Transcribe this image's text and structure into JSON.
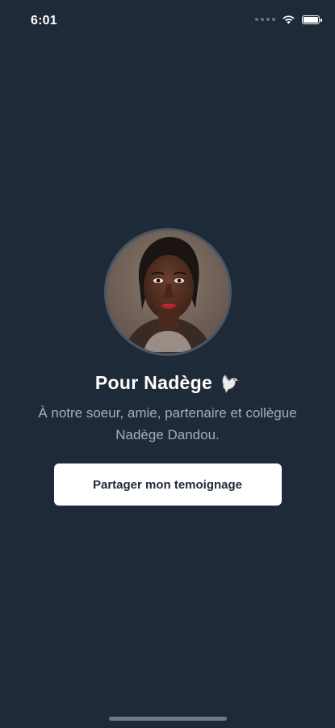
{
  "status_bar": {
    "time": "6:01",
    "battery_level": 1.0,
    "icons": [
      "signal-dots-icon",
      "wifi-icon",
      "battery-icon"
    ]
  },
  "profile": {
    "photo_alt": "Photo de Nadège",
    "title": "Pour Nadège",
    "title_emoji_icon": "dove-icon",
    "subtitle": "À notre soeur, amie, partenaire et collègue Nadège Dandou."
  },
  "actions": {
    "share_label": "Partager mon temoignage"
  },
  "colors": {
    "background": "#1f2a38",
    "text": "#ffffff",
    "muted_text": "#a4adb8",
    "button_bg": "#ffffff",
    "avatar_border": "#4a5766"
  }
}
